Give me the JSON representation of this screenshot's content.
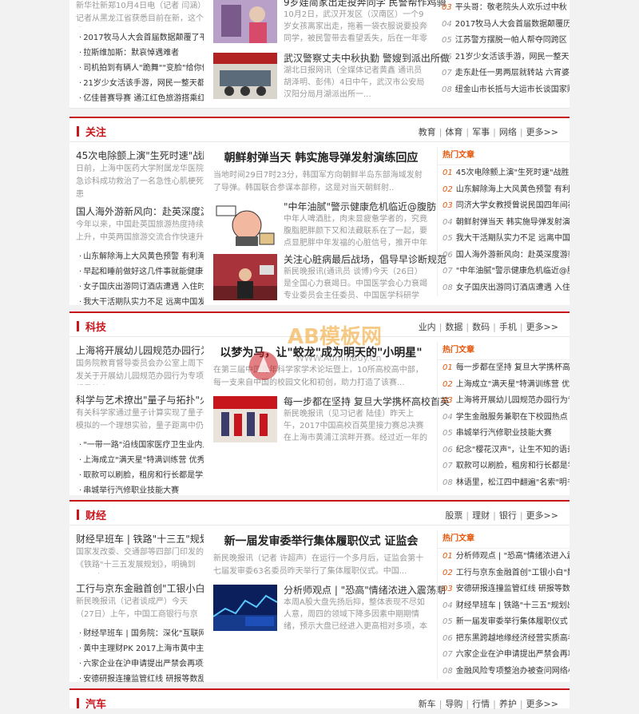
{
  "top": {
    "left_desc": "新华社新郑10月4日电（记者 闫涵）记者从黑龙江省获悉目前在新，这个省...",
    "left_items": [
      "2017牧马人大会首届数据颠覆了平日",
      "拉斯维加斯：默哀悼遇难者",
      "司机拍到有辆人\"跪舞\"\"变脸\"给你们",
      "21岁少女活该手游，网民一整天都疯火火",
      "亿佳普赛导赛 通江红色旅游搭乘红火"
    ],
    "mid_items": [
      {
        "title": "9岁娃简家出走投奔同学 民警帮作鸡骑",
        "desc": "10月2日，武汉开发区（汉南区）一个9岁女孩离家出走，拖着一袋衣服说要投奔同学，被民警带去看望丢失，后在一年零几个月..."
      },
      {
        "title": "武汉警察丈夫中秋执勤 警嫂到派出所做",
        "desc": "湖北日报网讯（全媒体记者黄鑫 通讯员胡泽明、彭伟）4日中午，武汉市公安局汉阳分局月湖派出所一..."
      }
    ],
    "right_items": [
      {
        "n": "03",
        "t": "平头哥：敬老院头人欢乐过中秋"
      },
      {
        "n": "04",
        "t": "2017牧马人大会首届数据颠覆历刷高点"
      },
      {
        "n": "05",
        "t": "江苏警方摆脱一帕人帮夺同跨区"
      },
      {
        "n": "06",
        "t": "21岁少女活该手游，网民一整天都疯了"
      },
      {
        "n": "07",
        "t": "走东赴任一男两层就转站 六宵婆婆中秋"
      },
      {
        "n": "08",
        "t": "纽金山市长抵与大运市长谈国家财经"
      }
    ]
  },
  "sections": [
    {
      "title": "关注",
      "tags": [
        "教育",
        "体育",
        "军事",
        "网络",
        "更多>>"
      ],
      "lead1": {
        "title": "45次电除颤上演\"生死时速\"战胜死",
        "desc": "日前，上海中医药大学附属龙华医院急诊科成功救治了一名急性心肌梗死患"
      },
      "lead2": {
        "title": "国人海外游新风向：赴英深度游新",
        "desc": "今年以来，中国赴英国旅游热度持续上升，中英两国旅游交流合作快速升温，且中国游客..."
      },
      "bullets": [
        "山东解除海上大风黄色预警 有利海航顺",
        "早起和睡前做好这几件事就能健康长寿",
        "女子国庆出游同订酒店遭遇 入住时却",
        "我大干活期队实力不足 远离中国发展"
      ],
      "mid_head": "朝鲜射弹当天 韩实施导弹发射演练回应",
      "mid_desc": "当地时间29日7时23分，韩国军方向朝鲜半岛东部海域发射了导弹。韩国联合参谋本部称，这是对当天朝鲜射..",
      "mid_items": [
        {
          "title": "\"中年油腻\"警示健康危机临近@腹肪",
          "desc": "中年人啤酒肚，肉未显疲惫学者的，究竟腹脂肥胖颜下又和法藏联系在了一起，要点显肥胖中年发福的心脏信号，推开中年的肥胖，..."
        },
        {
          "title": "关注心脏病最后战场，倡导早诊断规范",
          "desc": "新民晚报讯(通讯员 谈博)今天（26日）是全国心力衰竭日。中国医学会心力衰竭专业委员会主任委员、中国医学科研学会..."
        }
      ],
      "hot_title": "热门文章",
      "hot": [
        {
          "n": "01",
          "t": "45次电除颤上演\"生死时速\"战胜死神"
        },
        {
          "n": "02",
          "t": "山东解除海上大风黄色预警 有利海南顺"
        },
        {
          "n": "03",
          "t": "同济大学女教授曾说民国四年间被刊出"
        },
        {
          "n": "04",
          "t": "朝鲜射弹当天 韩实施导弹发射演练回应"
        },
        {
          "n": "05",
          "t": "我大干活期队实力不足 远离中国发展"
        },
        {
          "n": "06",
          "t": "国人海外游新风向：赴英深度游新趋势"
        },
        {
          "n": "07",
          "t": "\"中年油腻\"警示健康危机临近@腹肪"
        },
        {
          "n": "08",
          "t": "女子国庆出游同订酒店遭遇 入住时却被"
        }
      ]
    },
    {
      "title": "科技",
      "tags": [
        "业内",
        "数据",
        "数码",
        "手机",
        "更多>>"
      ],
      "lead1": {
        "title": "上海将开展幼儿园规范办园行为专",
        "desc": "国务院教育督导委员会办公室上周下发关于开展幼儿园规范办园行为专项督导检查..."
      },
      "lead2": {
        "title": "科学与艺术撩出\"量子与拓扑\"火花",
        "desc": "有关科学家通过量子计算实现了量子模拟的一个理想实验，量子距离中仍保留..."
      },
      "bullets": [
        "\"一带一路\"沿线国家医疗卫生业内人士",
        "上海成立\"满天星\"特满训练营 优秀营",
        "取款可以刷脸，租房和行长都是学生，上",
        "串城举行汽修职业技能大赛"
      ],
      "mid_head": "以梦为马，让\"蛟龙\"成为明天的\"小明星\"",
      "mid_desc": "在第三届中国青年科学家学术论坛暨上，10所高校高中部，每一支来自中国的校园文化和初创，助力打造了该赛...",
      "mid_items": [
        {
          "title": "每一步都在坚持 复旦大学携杯高校首英",
          "desc": "新民晚报讯（见习记者 陆佳）昨天上午，2017中国高校百英里接力赛总决赛在上海市黄浦江滨畔开赛。经过近一年的分赛场角逐，来..."
        }
      ],
      "hot_title": "热门文章",
      "hot": [
        {
          "n": "01",
          "t": "每一步都在坚持 复旦大学携杯高校首英"
        },
        {
          "n": "02",
          "t": "上海成立\"满天星\"特满训练营 优秀营"
        },
        {
          "n": "03",
          "t": "上海将开展幼儿园规范办园行为专项督导"
        },
        {
          "n": "04",
          "t": "学生金融服务兼职在下校园热点 宣川中"
        },
        {
          "n": "05",
          "t": "串城举行汽修职业技能大赛"
        },
        {
          "n": "06",
          "t": "纪念\"樱花汉声\"，让生不知的语录课本"
        },
        {
          "n": "07",
          "t": "取款可以刷脸，租房和行长都是学生"
        },
        {
          "n": "08",
          "t": "林语里，松江四中翻遍\"名索\"明书吧"
        }
      ]
    },
    {
      "title": "财经",
      "tags": [
        "股票",
        "理财",
        "银行",
        "更多>>"
      ],
      "lead1": {
        "title": "财经早班车 | 铁路\"十三五\"规划出炉",
        "desc": "国家发改委、交通部等四部门印发的《铁路\"十三五发展规划》，明确到2020年..."
      },
      "lead2": {
        "title": "工行与京东金融首创\"工银小白\"数",
        "desc": "新民晚报讯（记者谈成严）今天（27日）上午，中国工商银行与京东金融在北..."
      },
      "bullets": [
        "财经早班车 | 国务院：深化\"互联网+先",
        "黄中主理财PK 2017上海市黄中主任示范",
        "六家企业在沪申请提出严禁会再项最佳奖",
        "安德研报连撞监管红线 研报等数乱象依"
      ],
      "mid_head": "新一届发审委举行集体履职仪式 证监会",
      "mid_desc": "新民晚报讯（记者 许超声）在运行一个多月后，证监会第十七届发审委63名委员昨天举行了集体履职仪式。中国...",
      "mid_items": [
        {
          "title": "分析师观点 | \"恐高\"情绪浓进入震荡期",
          "desc": "本周A股大盘先扬后抑，整体表现不尽如人意，周四的领域下降多因素中期期情绪，预示大盘已经进入更高相对多项，本中几个交易日的走势..."
        }
      ],
      "hot_title": "热门文章",
      "hot": [
        {
          "n": "01",
          "t": "分析师观点 | \"恐高\"情绪浓进入震荡期"
        },
        {
          "n": "02",
          "t": "工行与京东金融首创\"工银小白\"数字银"
        },
        {
          "n": "03",
          "t": "安德研报连撞监管红线 研报等数乱象依"
        },
        {
          "n": "04",
          "t": "财经早班车 | 铁路\"十三五\"规划出炉"
        },
        {
          "n": "05",
          "t": "新一届发审委举行集体履职仪式 证监会"
        },
        {
          "n": "06",
          "t": "把东黑跨越地缘经济经营实质高考向"
        },
        {
          "n": "07",
          "t": "六家企业在沪申请提出严禁会再项最佳奖"
        },
        {
          "n": "08",
          "t": "金融风险专项整治办被查问网络小游"
        }
      ]
    }
  ],
  "bottom": {
    "title": "汽车",
    "tags": [
      "新车",
      "导购",
      "行情",
      "养护",
      "更多>>"
    ]
  },
  "watermark": {
    "text": "AB模板网",
    "url": "WWW.AdminBuy.Cn"
  }
}
